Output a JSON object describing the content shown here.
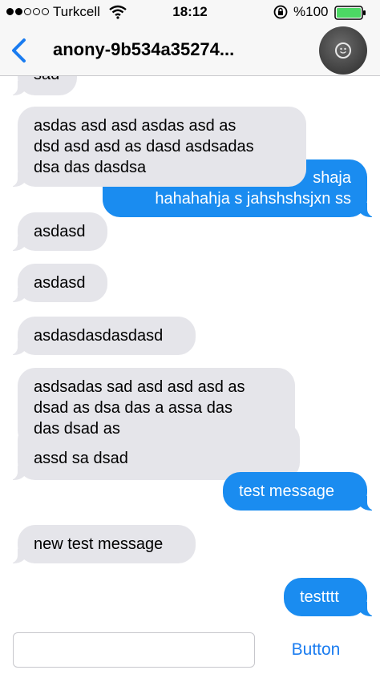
{
  "status_bar": {
    "carrier": "Turkcell",
    "time": "18:12",
    "battery": "%100",
    "signal_bars_filled": 2,
    "signal_bars_total": 5
  },
  "nav": {
    "title": "anony-9b534a35274...",
    "back_icon": "chevron-left-icon",
    "avatar_icon": "smiley-icon",
    "accent_color": "#1a7cf0"
  },
  "messages": [
    {
      "direction": "received",
      "lines": [
        "sad"
      ]
    },
    {
      "direction": "received",
      "lines": [
        "asdas asd asd asdas asd as",
        "dsd asd asd as dasd asdsadas",
        "dsa das dasdsa"
      ]
    },
    {
      "direction": "sent",
      "lines": [
        "shaja",
        "hahahahja s jahshshsjxn ss"
      ]
    },
    {
      "direction": "received",
      "lines": [
        "asdasd"
      ]
    },
    {
      "direction": "received",
      "lines": [
        "asdasd"
      ]
    },
    {
      "direction": "received",
      "lines": [
        "asdasdasdasdasd"
      ]
    },
    {
      "direction": "received",
      "lines": [
        "asdsadas sad asd asd asd as",
        "dsad as dsa das a assa das",
        "das dsad as"
      ]
    },
    {
      "direction": "received",
      "lines": [
        "assd sa dsad"
      ]
    },
    {
      "direction": "sent",
      "lines": [
        "test message"
      ]
    },
    {
      "direction": "received",
      "lines": [
        "new test message"
      ]
    },
    {
      "direction": "sent",
      "lines": [
        "testttt"
      ]
    }
  ],
  "input_bar": {
    "placeholder": "",
    "button_label": "Button"
  },
  "colors": {
    "received_bubble": "#e5e5ea",
    "sent_bubble": "#1a8cf0",
    "bar_background": "#f7f7f7"
  }
}
